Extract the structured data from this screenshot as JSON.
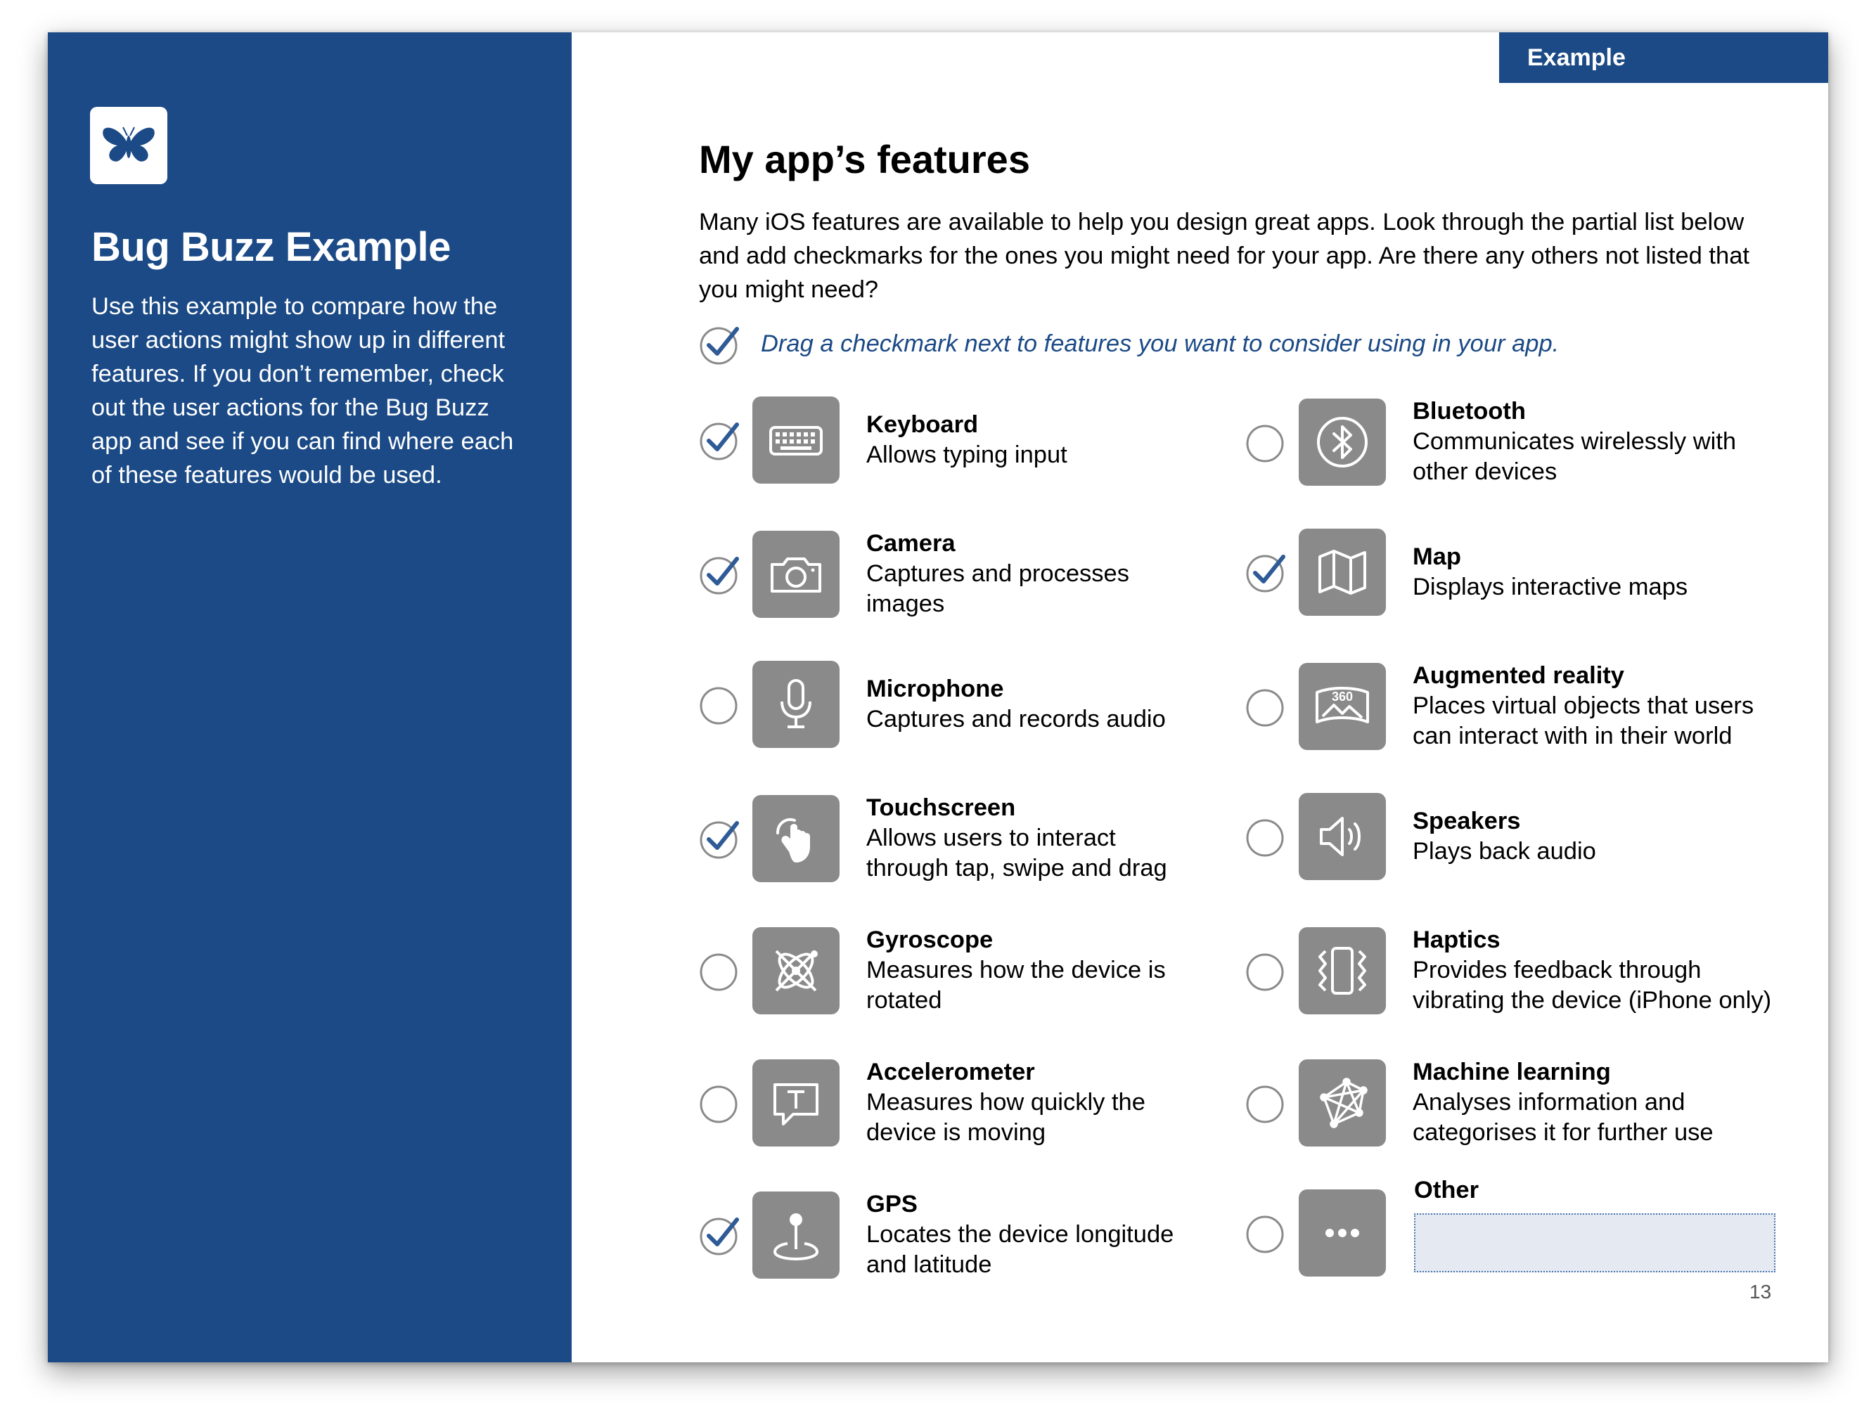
{
  "sidebar": {
    "title": "Bug Buzz Example",
    "body": "Use this example to compare how the user actions might show up in different features. If you don’t remember, check out the user actions for the Bug Buzz app and see if you can find where each of these features would be used.",
    "logo_icon": "butterfly-icon"
  },
  "tag": "Example",
  "main": {
    "title": "My app’s features",
    "intro": "Many iOS features are available to help you design great apps. Look through the partial list below and add checkmarks for the ones you might need for your app. Are there any others not listed that you might need?",
    "hint": "Drag a checkmark next to features you want to consider using in your app."
  },
  "features": [
    {
      "name": "Keyboard",
      "desc": "Allows typing input",
      "icon": "keyboard-icon",
      "checked": true
    },
    {
      "name": "Bluetooth",
      "desc": "Communicates wirelessly with other devices",
      "icon": "bluetooth-icon",
      "checked": false
    },
    {
      "name": "Camera",
      "desc": "Captures and processes images",
      "icon": "camera-icon",
      "checked": true
    },
    {
      "name": "Map",
      "desc": "Displays interactive maps",
      "icon": "map-icon",
      "checked": true
    },
    {
      "name": "Microphone",
      "desc": "Captures and records audio",
      "icon": "microphone-icon",
      "checked": false
    },
    {
      "name": "Augmented reality",
      "desc": "Places virtual objects that users can interact with in their world",
      "icon": "ar-360-icon",
      "checked": false
    },
    {
      "name": "Touchscreen",
      "desc": "Allows users to interact through tap, swipe and drag",
      "icon": "touch-hand-icon",
      "checked": true
    },
    {
      "name": "Speakers",
      "desc": "Plays back audio",
      "icon": "speaker-icon",
      "checked": false
    },
    {
      "name": "Gyroscope",
      "desc": "Measures how the device is rotated",
      "icon": "gyroscope-icon",
      "checked": false
    },
    {
      "name": "Haptics",
      "desc": "Provides feedback through vibrating the device (iPhone only)",
      "icon": "haptics-icon",
      "checked": false
    },
    {
      "name": "Accelerometer",
      "desc": "Measures how quickly the device is moving",
      "icon": "accelerometer-icon",
      "checked": false
    },
    {
      "name": "Machine learning",
      "desc": "Analyses information and categorises it for further use",
      "icon": "machine-learning-icon",
      "checked": false
    },
    {
      "name": "GPS",
      "desc": "Locates the device longitude and latitude",
      "icon": "gps-pin-icon",
      "checked": true
    },
    {
      "name": "Other",
      "desc": "",
      "icon": "more-dots-icon",
      "checked": false
    }
  ],
  "other_input_value": "",
  "page_number": "13",
  "colors": {
    "brand_blue": "#1b4a86",
    "icon_tile": "#8a8a8a",
    "checkmark": "#2e5a96",
    "radio_ring": "#8a8a8a",
    "input_fill": "#e5eaf2"
  }
}
